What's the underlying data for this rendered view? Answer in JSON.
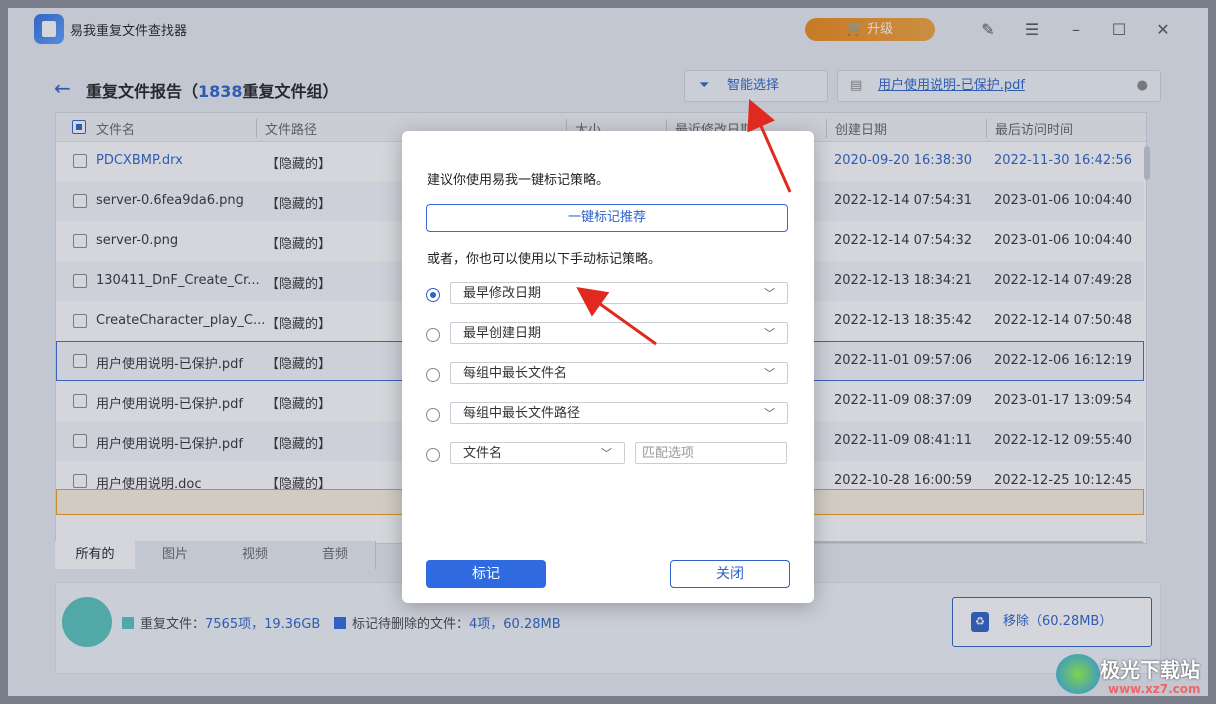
{
  "app": {
    "title": "易我重复文件查找器",
    "upgrade_label": "升级"
  },
  "header": {
    "title_prefix": "重复文件报告（",
    "count": "1838",
    "title_suffix": "重复文件组）",
    "smart_select": "智能选择",
    "file_name": "用户使用说明-已保护.pdf"
  },
  "table": {
    "columns": [
      "文件名",
      "文件路径",
      "大小",
      "最近修改日期",
      "创建日期",
      "最后访问时间"
    ],
    "rows": [
      {
        "name": "PDCXBMP.drx",
        "path": "【隐藏的】",
        "created": "2020-09-20 16:38:30",
        "accessed": "2022-11-30 16:42:56",
        "highlight": true
      },
      {
        "name": "server-0.6fea9da6.png",
        "path": "【隐藏的】",
        "created": "2022-12-14 07:54:31",
        "accessed": "2023-01-06 10:04:40"
      },
      {
        "name": "server-0.png",
        "path": "【隐藏的】",
        "created": "2022-12-14 07:54:32",
        "accessed": "2023-01-06 10:04:40"
      },
      {
        "name": "130411_DnF_Create_Cr...",
        "path": "【隐藏的】",
        "created": "2022-12-13 18:34:21",
        "accessed": "2022-12-14 07:49:28"
      },
      {
        "name": "CreateCharacter_play_C...",
        "path": "【隐藏的】",
        "created": "2022-12-13 18:35:42",
        "accessed": "2022-12-14 07:50:48"
      },
      {
        "name": "用户使用说明-已保护.pdf",
        "path": "【隐藏的】",
        "created": "2022-11-01 09:57:06",
        "accessed": "2022-12-06 16:12:19"
      },
      {
        "name": "用户使用说明-已保护.pdf",
        "path": "【隐藏的】",
        "created": "2022-11-09 08:37:09",
        "accessed": "2023-01-17 13:09:54"
      },
      {
        "name": "用户使用说明-已保护.pdf",
        "path": "【隐藏的】",
        "created": "2022-11-09 08:41:11",
        "accessed": "2022-12-12 09:55:40"
      },
      {
        "name": "用户使用说明.doc",
        "path": "【隐藏的】",
        "created": "2022-10-28 16:00:59",
        "accessed": "2022-12-25 10:12:45"
      }
    ]
  },
  "tabs": [
    "所有的",
    "图片",
    "视频",
    "音频"
  ],
  "bottom": {
    "dup_label": "重复文件：",
    "dup_value": "7565项，19.36GB",
    "mark_label": "标记待删除的文件：",
    "mark_value": "4项，60.28MB",
    "remove_label": "移除（60.28MB）",
    "colors": {
      "dup": "#58c4bb",
      "mark": "#2f6ae0"
    }
  },
  "dialog": {
    "suggest": "建议你使用易我一键标记策略。",
    "recommend_btn": "一键标记推荐",
    "or_manual": "或者，你也可以使用以下手动标记策略。",
    "options": [
      "最早修改日期",
      "最早创建日期",
      "每组中最长文件名",
      "每组中最长文件路径"
    ],
    "filename_option": "文件名",
    "match_placeholder": "匹配选项",
    "mark_btn": "标记",
    "close_btn": "关闭"
  },
  "watermark": {
    "title": "极光下载站",
    "url": "www.xz7.com"
  }
}
